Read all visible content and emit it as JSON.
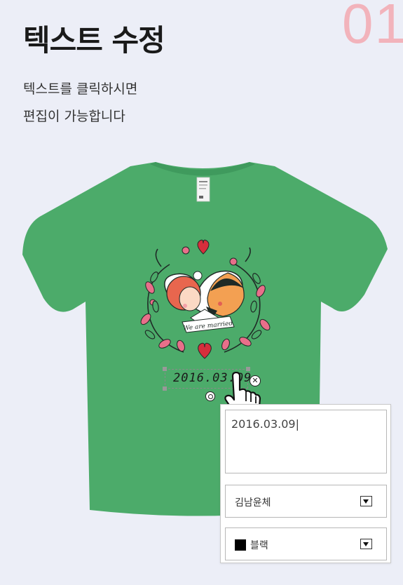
{
  "step_number": "01",
  "title": "텍스트 수정",
  "description": [
    "텍스트를 클릭하시면",
    "편집이 가능합니다"
  ],
  "tshirt": {
    "color": "#4cab6a",
    "design_banner_text": "We are married",
    "text_object_value": "2016.03.09"
  },
  "editor": {
    "text_value": "2016.03.09|",
    "font_select": {
      "selected": "김남윤체",
      "icon": "dropdown-arrow-icon"
    },
    "color_select": {
      "selected": "블랙",
      "swatch": "#000000",
      "icon": "dropdown-arrow-icon"
    }
  },
  "colors": {
    "step_number": "#f2b3bb",
    "background": "#eceef7",
    "heart": "#d62e3c"
  }
}
